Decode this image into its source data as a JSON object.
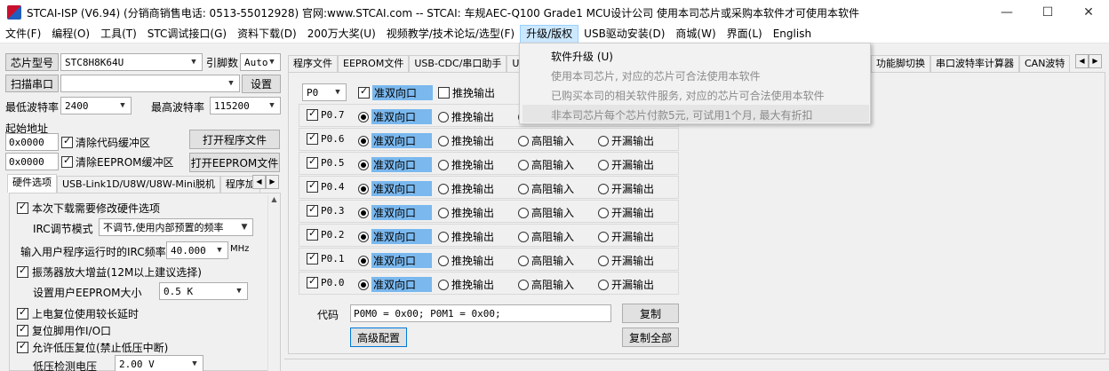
{
  "window": {
    "title": "STCAI-ISP (V6.94) (分销商销售电话: 0513-55012928) 官网:www.STCAI.com  -- STCAI: 车规AEC-Q100 Grade1 MCU设计公司 使用本司芯片或采购本软件才可使用本软件",
    "minimize": "—",
    "maximize": "☐",
    "close": "✕"
  },
  "menu": [
    "文件(F)",
    "编程(O)",
    "工具(T)",
    "STC调试接口(G)",
    "资料下载(D)",
    "200万大奖(U)",
    "视频教学/技术论坛/选型(F)",
    "升级/版权",
    "USB驱动安装(D)",
    "商城(W)",
    "界面(L)",
    "English"
  ],
  "dropdown": {
    "items": [
      "软件升级 (U)",
      "使用本司芯片, 对应的芯片可合法使用本软件",
      "已购买本司的相关软件服务, 对应的芯片可合法使用本软件",
      "非本司芯片每个芯片付款5元, 可试用1个月, 最大有折扣"
    ]
  },
  "left": {
    "chip_label": "芯片型号",
    "chip_value": "STC8H8K64U",
    "pins_label": "引脚数",
    "pins_value": "Auto",
    "scan_port": "扫描串口",
    "port_value": "",
    "settings": "设置",
    "min_baud_label": "最低波特率",
    "min_baud": "2400",
    "max_baud_label": "最高波特率",
    "max_baud": "115200",
    "start_addr_label": "起始地址",
    "addr1": "0x0000",
    "clear_code": "清除代码缓冲区",
    "open_prog": "打开程序文件",
    "addr2": "0x0000",
    "clear_eeprom": "清除EEPROM缓冲区",
    "open_eeprom": "打开EEPROM文件",
    "tabs": [
      "硬件选项",
      "USB-Link1D/U8W/U8W-Mini脱机",
      "程序加"
    ],
    "hw": {
      "opt1": "本次下载需要修改硬件选项",
      "irc_mode_label": "IRC调节模式",
      "irc_mode_value": "不调节,使用内部预置的频率",
      "irc_freq_label": "输入用户程序运行时的IRC频率",
      "irc_freq_value": "40.000",
      "irc_unit": "MHz",
      "osc": "振荡器放大增益(12M以上建议选择)",
      "eeprom_label": "设置用户EEPROM大小",
      "eeprom_value": "0.5 K",
      "power_delay": "上电复位使用较长延时",
      "reset_io": "复位脚用作I/O口",
      "lvr": "允许低压复位(禁止低压中断)",
      "lvd_label": "低压检测电压",
      "lvd_value": "2.00 V"
    }
  },
  "right": {
    "tabs": [
      "程序文件",
      "EEPROM文件",
      "USB-CDC/串口助手",
      "USB",
      "功能脚切换",
      "串口波特率计算器",
      "CAN波特"
    ],
    "port_select": "P0",
    "header": {
      "bidir": "准双向口",
      "push": "推挽输出"
    },
    "modes": {
      "bidir": "准双向口",
      "push": "推挽输出",
      "hiz": "高阻输入",
      "od": "开漏输出"
    },
    "pins": [
      "P0.7",
      "P0.6",
      "P0.5",
      "P0.4",
      "P0.3",
      "P0.2",
      "P0.1",
      "P0.0"
    ],
    "code_label": "代码",
    "code_value": "P0M0 = 0x00; P0M1 = 0x00;",
    "copy": "复制",
    "copy_all": "复制全部",
    "advanced": "高级配置"
  }
}
